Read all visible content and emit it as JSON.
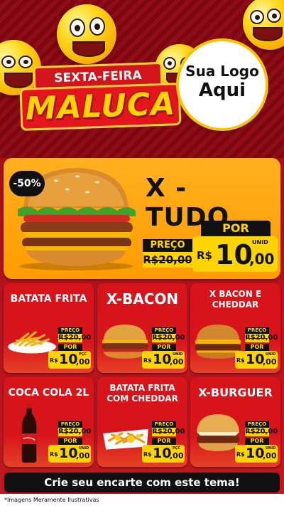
{
  "header": {
    "banner_line1": "SEXTA-FEIRA",
    "banner_line2": "MALUCA",
    "logo_line1": "Sua Logo",
    "logo_line2": "Aqui"
  },
  "featured": {
    "discount": "-50%",
    "name": "X - TUDO",
    "old_label": "PREÇO",
    "old_price": "R$20,00",
    "new_label": "POR",
    "currency": "R$",
    "price_int": "10",
    "price_cents": ",00",
    "unit": "UNID"
  },
  "items": [
    {
      "name": "BATATA FRITA",
      "old_label": "PREÇO",
      "old_price": "R$20,00",
      "new_label": "POR",
      "currency": "R$",
      "price_int": "10",
      "price_cents": ",00",
      "unit": "PÇC"
    },
    {
      "name": "X-BACON",
      "old_label": "PREÇO",
      "old_price": "R$20,00",
      "new_label": "POR",
      "currency": "R$",
      "price_int": "10",
      "price_cents": ",00",
      "unit": "UNID"
    },
    {
      "name": "X BACON E CHEDDAR",
      "old_label": "PREÇO",
      "old_price": "R$20,00",
      "new_label": "POR",
      "currency": "R$",
      "price_int": "10",
      "price_cents": ",00",
      "unit": "UNID"
    },
    {
      "name": "COCA COLA 2L",
      "old_label": "PREÇO",
      "old_price": "R$20,00",
      "new_label": "POR",
      "currency": "R$",
      "price_int": "10",
      "price_cents": ",00",
      "unit": "UNID"
    },
    {
      "name": "BATATA FRITA COM CHEDDAR",
      "old_label": "PREÇO",
      "old_price": "R$20,00",
      "new_label": "POR",
      "currency": "R$",
      "price_int": "10",
      "price_cents": ",00",
      "unit": "PÇC"
    },
    {
      "name": "X-BURGUER",
      "old_label": "PREÇO",
      "old_price": "R$20,00",
      "new_label": "POR",
      "currency": "R$",
      "price_int": "10",
      "price_cents": ",00",
      "unit": "UNID"
    }
  ],
  "cta": "Crie seu encarte com este tema!",
  "footnote": "*Imagens Meramente Ilustrativas",
  "colors": {
    "primary_red": "#d8141b",
    "accent_yellow": "#ffd400",
    "orange": "#ff9c00",
    "dark": "#111111"
  },
  "icons": [
    "emoji-wink-icon",
    "emoji-laugh-icon",
    "burger-image",
    "fries-image",
    "soda-bottle-image",
    "cheese-fries-image"
  ]
}
